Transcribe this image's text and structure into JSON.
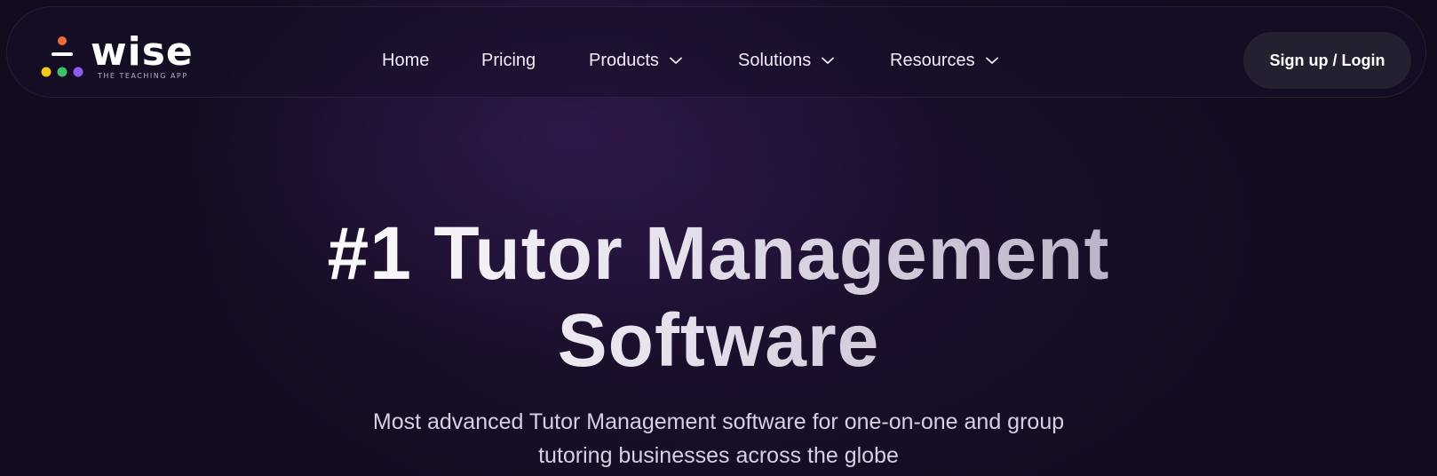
{
  "logo": {
    "wordmark": "wise",
    "tagline": "THE TEACHING APP",
    "colors": {
      "top": "#ee6b3c",
      "dot1": "#f5c518",
      "dot2": "#3fbf6a",
      "dot3": "#8a5cf6"
    }
  },
  "nav": {
    "items": [
      {
        "label": "Home",
        "has_dropdown": false
      },
      {
        "label": "Pricing",
        "has_dropdown": false
      },
      {
        "label": "Products",
        "has_dropdown": true
      },
      {
        "label": "Solutions",
        "has_dropdown": true
      },
      {
        "label": "Resources",
        "has_dropdown": true
      }
    ],
    "cta_label": "Sign up / Login"
  },
  "hero": {
    "title_line1": "#1 Tutor Management",
    "title_line2": "Software",
    "subtitle_line1": "Most advanced Tutor Management software for one-on-one and group",
    "subtitle_line2": "tutoring businesses across the globe"
  },
  "theme": {
    "background": "#130c1f",
    "button_bg": "#25202f",
    "text": "#f1edf7"
  }
}
